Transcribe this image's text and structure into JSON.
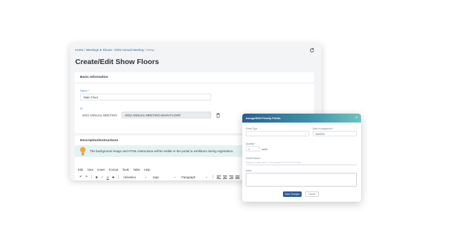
{
  "breadcrumb": {
    "home": "Home",
    "sep1": "/",
    "meetings": "Meetings & Shows",
    "sep2": "/",
    "meeting": "2022 Annual Meeting",
    "sep3": "/",
    "current": "Setup"
  },
  "page_title": "Create/Edit Show Floors",
  "basic_info": {
    "header": "Basic Information",
    "name_label": "Name *",
    "name_value": "Main Floor",
    "id_label": "ID",
    "id_prefix": "2022 ANNUAL MEETING",
    "id_value": "2022 ANNUAL MEETING-MAIN-FLOOR"
  },
  "description": {
    "header": "Description/Instructions",
    "info_text": "The background image and HTML instructions will be visible in the portal to exhibitors during registration.",
    "menu": [
      "Edit",
      "View",
      "Insert",
      "Format",
      "Tools",
      "Table",
      "Help"
    ],
    "font_family": "Helvetica",
    "font_size": "14px",
    "block_format": "Paragraph",
    "format_buttons": [
      "B",
      "I",
      "U",
      "S"
    ]
  },
  "modal": {
    "title": "Assign/Edit Priority Points",
    "field1_label": "Points Type",
    "field2_label": "Date of Assignment *",
    "field2_value": "5/6/2023",
    "points_label": "Quantity *",
    "points_value": "1",
    "points_unit": "points",
    "reason_label": "Credit Reason *",
    "reason_placeholder": "Choose a credit reason or Text-based list (or select from list)",
    "notes_label": "Notes",
    "save_label": "Save Changes",
    "cancel_label": "Cancel"
  },
  "colors": {
    "primary": "#2c5f95",
    "banner": "#e3f3f2",
    "link": "#2c6aa0",
    "bulb": "#f2a73b"
  },
  "icons": [
    "refresh-icon",
    "trash-icon",
    "lightbulb-icon",
    "undo-icon",
    "redo-icon",
    "close-icon",
    "chevron-down-icon"
  ]
}
